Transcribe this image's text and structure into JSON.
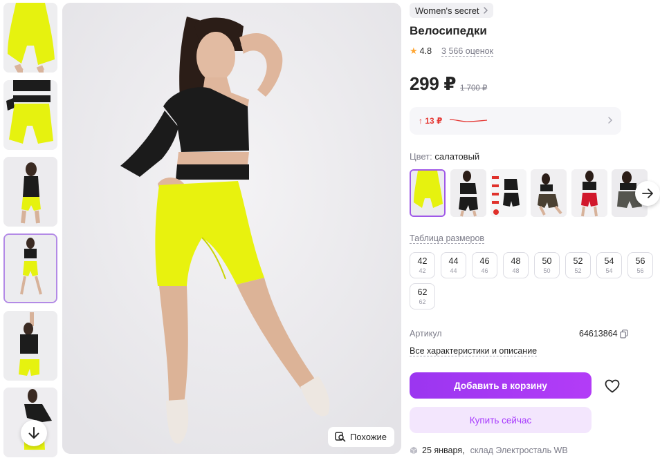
{
  "brand": {
    "label": "Women's secret"
  },
  "product": {
    "title": "Велосипедки",
    "rating": "4.8",
    "reviews": "3 566 оценок",
    "price": "299 ₽",
    "old_price": "1 700 ₽",
    "article_label": "Артикул",
    "article": "64613864",
    "all_specs": "Все характеристики и описание"
  },
  "price_history": {
    "delta": "↑ 13 ₽"
  },
  "color": {
    "label": "Цвет:",
    "value": "салатовый"
  },
  "size_table": {
    "label": "Таблица размеров"
  },
  "sizes": [
    {
      "ru": "42",
      "int": "42"
    },
    {
      "ru": "44",
      "int": "44"
    },
    {
      "ru": "46",
      "int": "46"
    },
    {
      "ru": "48",
      "int": "48"
    },
    {
      "ru": "50",
      "int": "50"
    },
    {
      "ru": "52",
      "int": "52"
    },
    {
      "ru": "54",
      "int": "54"
    },
    {
      "ru": "56",
      "int": "56"
    },
    {
      "ru": "62",
      "int": "62"
    }
  ],
  "actions": {
    "add_to_cart": "Добавить в корзину",
    "buy_now": "Купить сейчас",
    "similar": "Похожие"
  },
  "delivery": {
    "date": "25 января,",
    "warehouse": "склад Электросталь WB"
  },
  "colors_ui": {
    "accent": "#a73afd",
    "accent_light": "#f3e6fd",
    "neon": "#e6f20f",
    "price_up": "#e53935"
  }
}
